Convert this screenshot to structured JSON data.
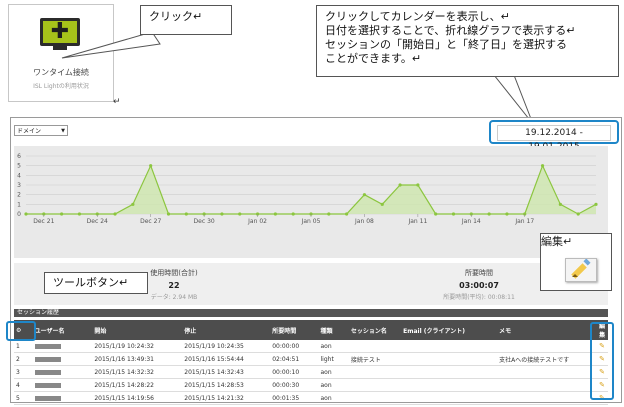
{
  "tile": {
    "title": "ワンタイム接続",
    "subtitle": "ISL Lightの利用状況",
    "icon": "monitor-plus-icon"
  },
  "callouts": {
    "click": "クリック↵",
    "calendar": [
      "クリックしてカレンダーを表示し、↵",
      "日付を選択することで、折れ線グラフで表示する↵",
      "セッションの「開始日」と「終了日」を選択する",
      "ことができます。↵"
    ],
    "tool": "ツールボタン↵",
    "edit": "編集↵"
  },
  "domain_select": {
    "label": "ドメイン"
  },
  "daterange": {
    "value": "19.12.2014  -  19.01.2015"
  },
  "chart_data": {
    "type": "line",
    "x_tick_labels": [
      "Dec 21",
      "Dec 24",
      "Dec 27",
      "Dec 30",
      "Jan 02",
      "Jan 05",
      "Jan 08",
      "Jan 11",
      "Jan 14",
      "Jan 17"
    ],
    "y_tick_labels": [
      "0",
      "1",
      "2",
      "3",
      "4",
      "5",
      "6"
    ],
    "ylim": [
      0,
      6
    ],
    "values": [
      0,
      0,
      0,
      0,
      0,
      0,
      1,
      5,
      0,
      0,
      0,
      0,
      0,
      0,
      0,
      0,
      0,
      0,
      0,
      2,
      1,
      3,
      3,
      0,
      0,
      0,
      0,
      0,
      0,
      5,
      1,
      0,
      1
    ],
    "grid": true,
    "color": "#8cc63f"
  },
  "stats": [
    {
      "label": "使用時間(合計)",
      "value": "22",
      "note": "データ: 2.94 MB"
    },
    {
      "label": "所要時間",
      "value": "03:00:07",
      "note": "所要時間(平均): 00:08:11"
    }
  ],
  "section_label": "セッション履歴",
  "table": {
    "headers": [
      "",
      "ユーザー名",
      "開始",
      "停止",
      "所要時間",
      "種類",
      "セッション名",
      "Email (クライアント)",
      "メモ",
      "編集"
    ],
    "rows": [
      {
        "n": "1",
        "start": "2015/1/19 10:24:32",
        "stop": "2015/1/19 10:24:35",
        "dur": "00:00:00",
        "type": "aon",
        "name": "",
        "email": "",
        "memo": ""
      },
      {
        "n": "2",
        "start": "2015/1/16 13:49:31",
        "stop": "2015/1/16 15:54:44",
        "dur": "02:04:51",
        "type": "light",
        "name": "接続テスト",
        "email": "",
        "memo": "支社Aへの接続テストです"
      },
      {
        "n": "3",
        "start": "2015/1/15 14:32:32",
        "stop": "2015/1/15 14:32:43",
        "dur": "00:00:10",
        "type": "aon",
        "name": "",
        "email": "",
        "memo": ""
      },
      {
        "n": "4",
        "start": "2015/1/15 14:28:22",
        "stop": "2015/1/15 14:28:53",
        "dur": "00:00:30",
        "type": "aon",
        "name": "",
        "email": "",
        "memo": ""
      },
      {
        "n": "5",
        "start": "2015/1/15 14:19:56",
        "stop": "2015/1/15 14:21:32",
        "dur": "00:01:35",
        "type": "aon",
        "name": "",
        "email": "",
        "memo": ""
      }
    ]
  }
}
